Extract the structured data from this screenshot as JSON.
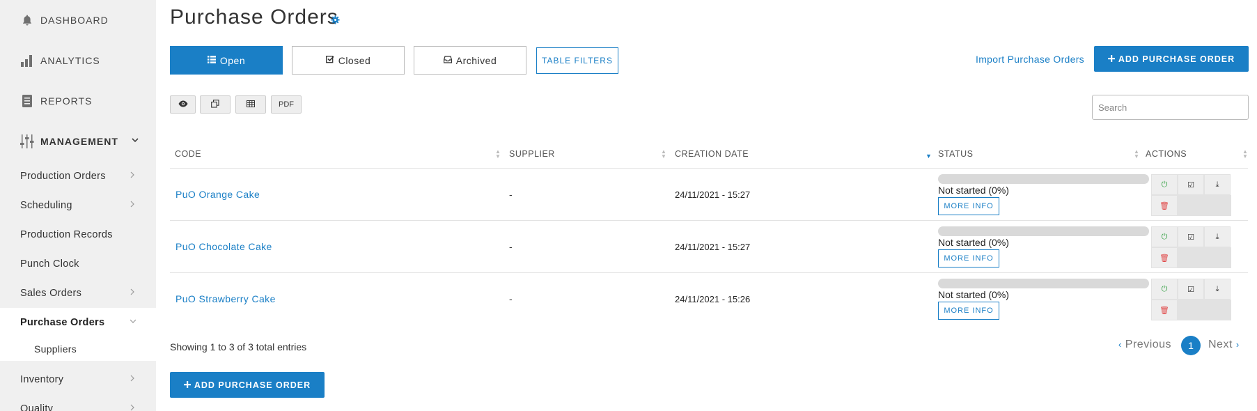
{
  "sidebar": {
    "top_items": [
      {
        "label": "DASHBOARD",
        "icon": "bell-icon"
      },
      {
        "label": "ANALYTICS",
        "icon": "bar-chart-icon"
      },
      {
        "label": "REPORTS",
        "icon": "report-icon"
      }
    ],
    "management": {
      "label": "MANAGEMENT",
      "icon": "sliders-icon"
    },
    "items": [
      {
        "label": "Production Orders",
        "has_chevron": true
      },
      {
        "label": "Scheduling",
        "has_chevron": true
      },
      {
        "label": "Production Records",
        "has_chevron": false
      },
      {
        "label": "Punch Clock",
        "has_chevron": false
      },
      {
        "label": "Sales Orders",
        "has_chevron": true
      },
      {
        "label": "Purchase Orders",
        "has_chevron": true,
        "active": true
      },
      {
        "label": "Suppliers",
        "sub": true
      },
      {
        "label": "Inventory",
        "has_chevron": true
      },
      {
        "label": "Quality",
        "has_chevron": true
      }
    ]
  },
  "header": {
    "title": "Purchase Orders"
  },
  "tabs": [
    {
      "label": "Open",
      "active": true
    },
    {
      "label": "Closed",
      "active": false
    },
    {
      "label": "Archived",
      "active": false
    }
  ],
  "toolbar": {
    "table_filters": "TABLE FILTERS",
    "import": "Import Purchase Orders",
    "add": "ADD PURCHASE ORDER",
    "pdf": "PDF",
    "search_placeholder": "Search"
  },
  "table": {
    "columns": [
      "CODE",
      "SUPPLIER",
      "CREATION DATE",
      "STATUS",
      "ACTIONS"
    ],
    "rows": [
      {
        "code": "PuO Orange Cake",
        "supplier": "-",
        "date": "24/11/2021 - 15:27",
        "progress": 0,
        "status": "Not started (0%)",
        "more": "MORE INFO"
      },
      {
        "code": "PuO Chocolate Cake",
        "supplier": "-",
        "date": "24/11/2021 - 15:27",
        "progress": 0,
        "status": "Not started (0%)",
        "more": "MORE INFO"
      },
      {
        "code": "PuO Strawberry Cake",
        "supplier": "-",
        "date": "24/11/2021 - 15:26",
        "progress": 0,
        "status": "Not started (0%)",
        "more": "MORE INFO"
      }
    ]
  },
  "footer": {
    "showing": "Showing 1 to 3 of 3 total entries",
    "prev": "Previous",
    "page": "1",
    "next": "Next",
    "add": "ADD PURCHASE ORDER"
  },
  "colors": {
    "accent": "#1a7fc6",
    "power": "#2a9d3a",
    "delete": "#e04848"
  }
}
